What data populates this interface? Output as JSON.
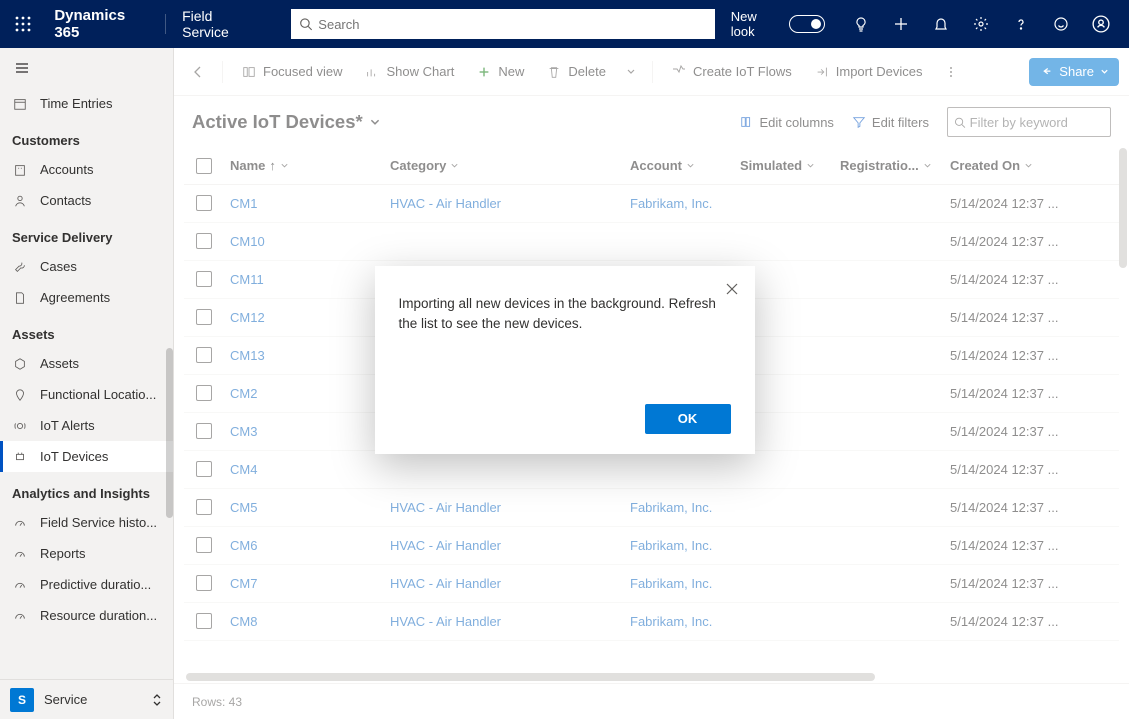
{
  "topbar": {
    "brand": "Dynamics 365",
    "app": "Field Service",
    "search_placeholder": "Search",
    "newlook_label": "New look"
  },
  "nav": {
    "item_time_entries": "Time Entries",
    "group_customers": "Customers",
    "item_accounts": "Accounts",
    "item_contacts": "Contacts",
    "group_service_delivery": "Service Delivery",
    "item_cases": "Cases",
    "item_agreements": "Agreements",
    "group_assets": "Assets",
    "item_assets": "Assets",
    "item_functional_locations": "Functional Locatio...",
    "item_iot_alerts": "IoT Alerts",
    "item_iot_devices": "IoT Devices",
    "group_analytics": "Analytics and Insights",
    "item_fs_history": "Field Service histo...",
    "item_reports": "Reports",
    "item_predictive": "Predictive duratio...",
    "item_resource": "Resource duration...",
    "switcher_initial": "S",
    "switcher_label": "Service"
  },
  "cmd": {
    "focused_view": "Focused view",
    "show_chart": "Show Chart",
    "new": "New",
    "delete": "Delete",
    "create_flows": "Create IoT Flows",
    "import_devices": "Import Devices",
    "share": "Share"
  },
  "view": {
    "title": "Active IoT Devices*",
    "edit_columns": "Edit columns",
    "edit_filters": "Edit filters",
    "filter_placeholder": "Filter by keyword"
  },
  "columns": {
    "name": "Name",
    "category": "Category",
    "account": "Account",
    "simulated": "Simulated",
    "registration": "Registratio...",
    "created_on": "Created On"
  },
  "rows": [
    {
      "name": "CM1",
      "category": "HVAC - Air Handler",
      "account": "Fabrikam, Inc.",
      "created_on": "5/14/2024 12:37 ..."
    },
    {
      "name": "CM10",
      "category": "",
      "account": "",
      "created_on": "5/14/2024 12:37 ..."
    },
    {
      "name": "CM11",
      "category": "",
      "account": "",
      "created_on": "5/14/2024 12:37 ..."
    },
    {
      "name": "CM12",
      "category": "",
      "account": "",
      "created_on": "5/14/2024 12:37 ..."
    },
    {
      "name": "CM13",
      "category": "",
      "account": "",
      "created_on": "5/14/2024 12:37 ..."
    },
    {
      "name": "CM2",
      "category": "",
      "account": "",
      "created_on": "5/14/2024 12:37 ..."
    },
    {
      "name": "CM3",
      "category": "",
      "account": "",
      "created_on": "5/14/2024 12:37 ..."
    },
    {
      "name": "CM4",
      "category": "",
      "account": "",
      "created_on": "5/14/2024 12:37 ..."
    },
    {
      "name": "CM5",
      "category": "HVAC - Air Handler",
      "account": "Fabrikam, Inc.",
      "created_on": "5/14/2024 12:37 ..."
    },
    {
      "name": "CM6",
      "category": "HVAC - Air Handler",
      "account": "Fabrikam, Inc.",
      "created_on": "5/14/2024 12:37 ..."
    },
    {
      "name": "CM7",
      "category": "HVAC - Air Handler",
      "account": "Fabrikam, Inc.",
      "created_on": "5/14/2024 12:37 ..."
    },
    {
      "name": "CM8",
      "category": "HVAC - Air Handler",
      "account": "Fabrikam, Inc.",
      "created_on": "5/14/2024 12:37 ..."
    }
  ],
  "footer": {
    "rows_label": "Rows: 43"
  },
  "dialog": {
    "message": "Importing all new devices in the background. Refresh the list to see the new devices.",
    "ok": "OK"
  }
}
